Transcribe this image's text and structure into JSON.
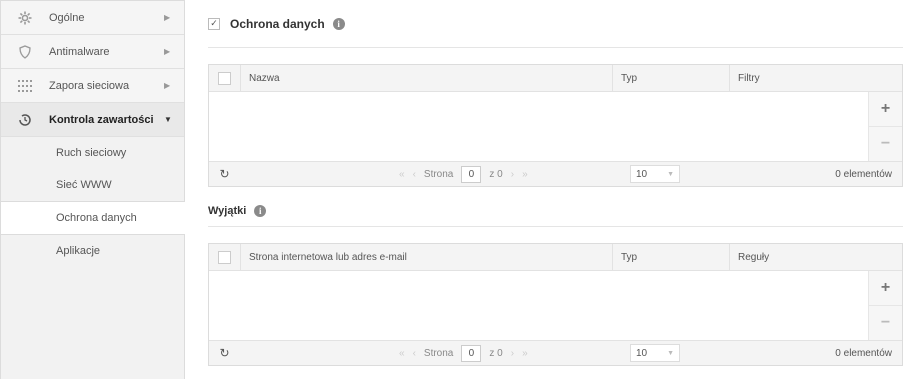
{
  "sidebar": {
    "items": [
      {
        "label": "Ogólne",
        "icon": "gear-icon"
      },
      {
        "label": "Antimalware",
        "icon": "shield-icon"
      },
      {
        "label": "Zapora sieciowa",
        "icon": "firewall-icon"
      },
      {
        "label": "Kontrola zawartości",
        "icon": "content-control-icon"
      }
    ],
    "sub_items": [
      "Ruch sieciowy",
      "Sieć WWW",
      "Ochrona danych",
      "Aplikacje"
    ]
  },
  "section": {
    "title": "Ochrona danych",
    "checked": "✓",
    "columns": [
      "Nazwa",
      "Typ",
      "Filtry"
    ]
  },
  "exceptions": {
    "title": "Wyjątki",
    "columns": [
      "Strona internetowa lub adres e-mail",
      "Typ",
      "Reguły"
    ]
  },
  "pager": {
    "page_label": "Strona",
    "page_value": "0",
    "of_label": "z 0",
    "page_size": "10",
    "count": "0 elementów"
  },
  "info_glyph": "i"
}
